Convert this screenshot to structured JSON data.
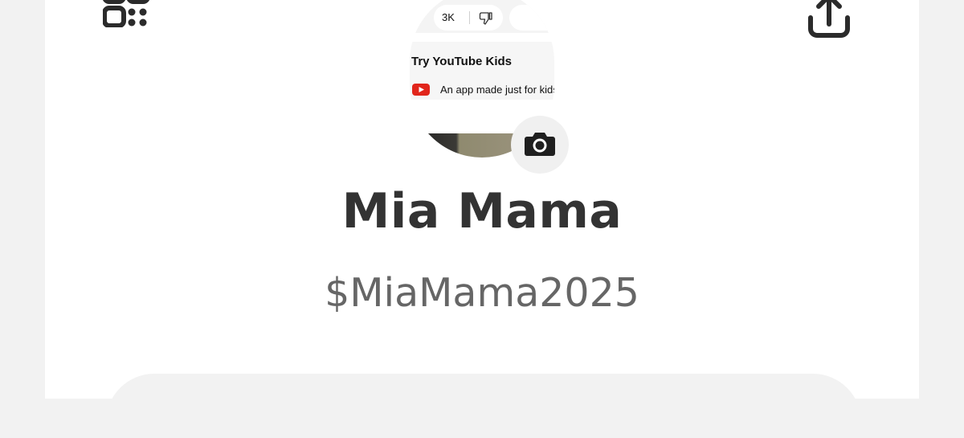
{
  "profile": {
    "display_name": "Mia Mama",
    "cashtag": "$MiaMama2025"
  },
  "avatar_screenshot": {
    "like_count": "3K",
    "promo_title": "Try YouTube Kids",
    "promo_subtitle": "An app made just for kids"
  },
  "icons": {
    "qr": "qr-code-icon",
    "share": "share-icon",
    "camera": "camera-icon",
    "dislike": "thumbs-down-icon",
    "youtube": "youtube-logo-icon"
  },
  "colors": {
    "name_text": "#333333",
    "cashtag_text": "#666666",
    "icon": "#2b2b2b",
    "background": "#f2f2f2",
    "card": "#ffffff"
  }
}
